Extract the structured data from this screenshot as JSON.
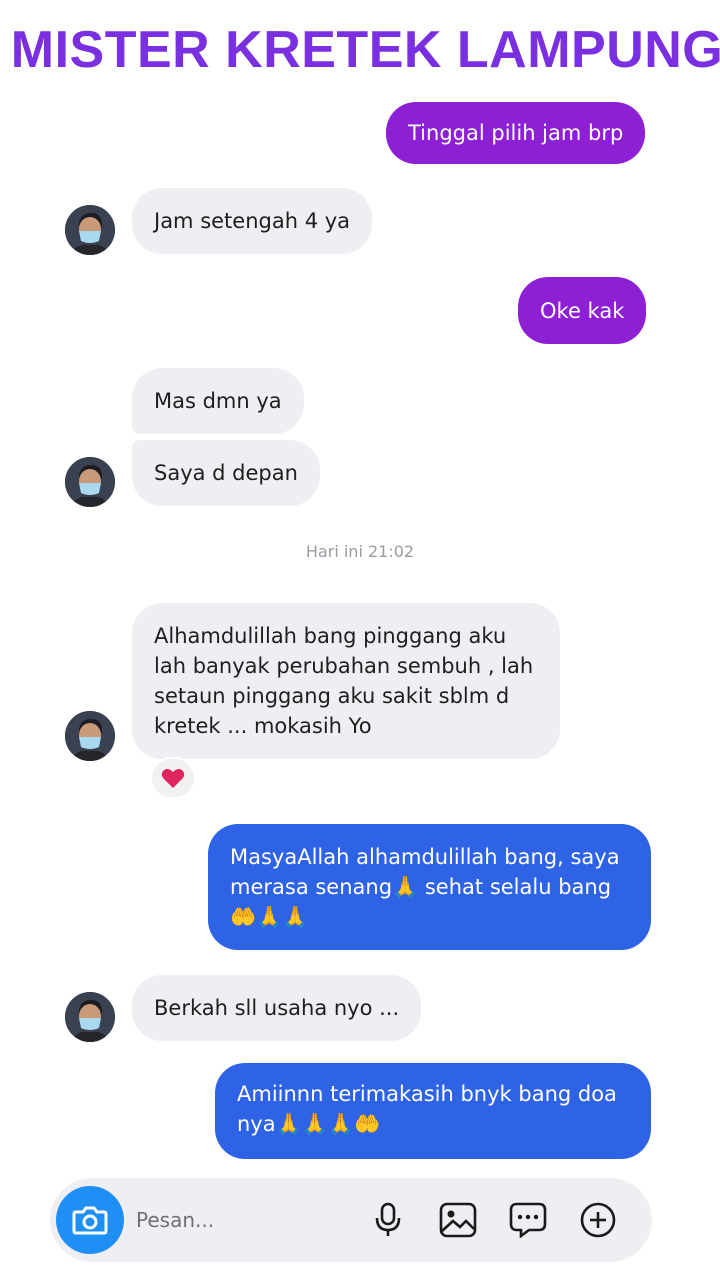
{
  "header": {
    "title": "MISTER KRETEK LAMPUNG",
    "icon": "location-pin-icon",
    "color": "#7a2fe0"
  },
  "messages": {
    "m1": "Tinggal pilih jam brp",
    "m2": "Jam setengah 4 ya",
    "m3": "Oke kak",
    "m4": "Mas dmn ya",
    "m5": "Saya d depan",
    "m6": "Alhamdulillah bang pinggang aku lah banyak perubahan sembuh , lah setaun pinggang aku sakit sblm d kretek ... mokasih Yo",
    "m7": "MasyaAllah alhamdulillah bang, saya merasa senang🙏 sehat selalu bang 🤲🙏🙏",
    "m8": "Berkah sll usaha nyo ...",
    "m9": "Amiinnn terimakasih bnyk bang doa nya🙏🙏🙏🤲"
  },
  "timestamp": "Hari ini 21:02",
  "reaction": {
    "emoji": "❤️",
    "color": "#e0245e"
  },
  "composer": {
    "placeholder": "Pesan...",
    "icons": [
      "camera-icon",
      "microphone-icon",
      "gallery-icon",
      "sticker-icon",
      "plus-icon"
    ]
  },
  "colors": {
    "purple_bubble": "#8d1fd4",
    "blue_bubble": "#2f63e6",
    "incoming_bubble": "#efeef2",
    "camera_button": "#1f8ff5"
  }
}
